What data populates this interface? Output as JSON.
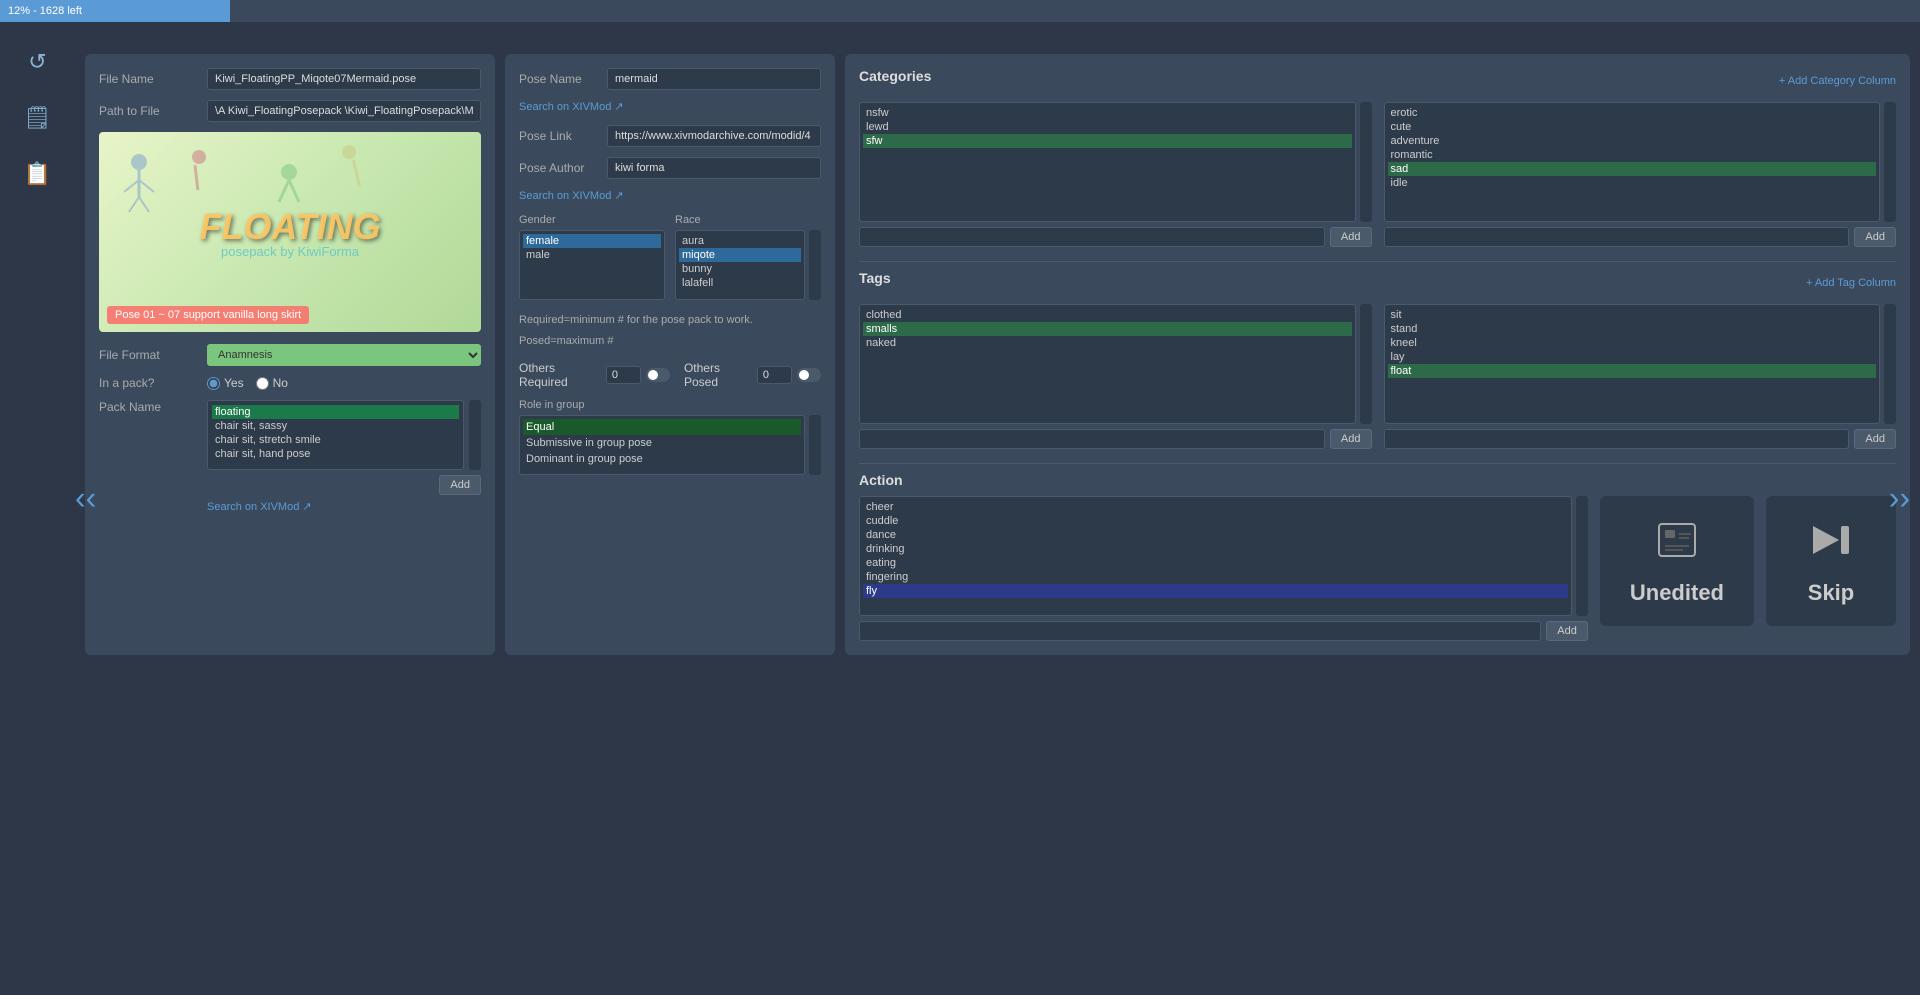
{
  "progress": {
    "text": "12% - 1628 left",
    "percent": 12
  },
  "sidebar": {
    "icons": [
      {
        "name": "refresh-icon",
        "symbol": "↺"
      },
      {
        "name": "info-icon",
        "symbol": "🗒"
      },
      {
        "name": "notes-icon",
        "symbol": "📋"
      }
    ]
  },
  "left_panel": {
    "file_name_label": "File Name",
    "file_name_value": "Kiwi_FloatingPP_Miqote07Mermaid.pose",
    "path_label": "Path to File",
    "path_value": "\\A Kiwi_FloatingPosepack \\Kiwi_FloatingPosepack\\Miqote",
    "pose_image_title": "FLOATING",
    "pose_image_subtitle": "posepack by KiwiForma",
    "pose_image_caption": "Pose 01 ~ 07 support vanilla long skirt",
    "file_format_label": "File Format",
    "file_format_value": "Anamnesis",
    "in_pack_label": "In a pack?",
    "radio_yes": "Yes",
    "radio_no": "No",
    "pack_name_label": "Pack Name",
    "pack_items": [
      {
        "label": "floating",
        "selected": true
      },
      {
        "label": "chair sit, sassy",
        "selected": false
      },
      {
        "label": "chair sit, stretch smile",
        "selected": false
      },
      {
        "label": "chair sit, hand pose",
        "selected": false
      }
    ],
    "add_label": "Add",
    "search_label": "Search on XIVMod ↗"
  },
  "middle_panel": {
    "pose_name_label": "Pose Name",
    "pose_name_value": "mermaid",
    "pose_link_label": "Pose Link",
    "pose_link_value": "https://www.xivmodarchive.com/modid/4",
    "pose_author_label": "Pose Author",
    "pose_author_value": "kiwi forma",
    "search_label": "Search on XIVMod ↗",
    "gender_label": "Gender",
    "gender_items": [
      {
        "label": "female",
        "selected": true
      },
      {
        "label": "male",
        "selected": false
      }
    ],
    "race_label": "Race",
    "race_items": [
      {
        "label": "aura",
        "selected": false
      },
      {
        "label": "miqote",
        "selected": true
      },
      {
        "label": "bunny",
        "selected": false
      },
      {
        "label": "lalafell",
        "selected": false
      }
    ],
    "required_text1": "Required=minimum # for the pose pack to work.",
    "required_text2": "Posed=maximum #",
    "others_required_label": "Others Required",
    "others_required_value": "0",
    "others_posed_label": "Others Posed",
    "others_posed_value": "0",
    "role_label": "Role in group",
    "role_items": [
      {
        "label": "Equal",
        "selected": true
      },
      {
        "label": "Submissive in group pose",
        "selected": false
      },
      {
        "label": "Dominant in group pose",
        "selected": false
      }
    ]
  },
  "right_panel": {
    "categories_title": "Categories",
    "add_category_link": "+ Add Category Column",
    "category_col1_items": [
      {
        "label": "nsfw",
        "selected": false
      },
      {
        "label": "lewd",
        "selected": false
      },
      {
        "label": "sfw",
        "selected": true
      }
    ],
    "category_col2_items": [
      {
        "label": "erotic",
        "selected": false
      },
      {
        "label": "cute",
        "selected": false
      },
      {
        "label": "adventure",
        "selected": false
      },
      {
        "label": "romantic",
        "selected": false
      },
      {
        "label": "sad",
        "selected": true
      },
      {
        "label": "idle",
        "selected": false
      }
    ],
    "tags_title": "Tags",
    "add_tag_link": "+ Add Tag Column",
    "tag_col1_items": [
      {
        "label": "clothed",
        "selected": false
      },
      {
        "label": "smalls",
        "selected": true
      },
      {
        "label": "naked",
        "selected": false
      }
    ],
    "tag_col2_items": [
      {
        "label": "sit",
        "selected": false
      },
      {
        "label": "stand",
        "selected": false
      },
      {
        "label": "kneel",
        "selected": false
      },
      {
        "label": "lay",
        "selected": false
      },
      {
        "label": "float",
        "selected": true
      }
    ],
    "action_title": "Action",
    "action_items": [
      {
        "label": "cheer",
        "selected": false
      },
      {
        "label": "cuddle",
        "selected": false
      },
      {
        "label": "dance",
        "selected": false
      },
      {
        "label": "drinking",
        "selected": false
      },
      {
        "label": "eating",
        "selected": false
      },
      {
        "label": "fingering",
        "selected": false
      },
      {
        "label": "fly",
        "selected": true
      }
    ],
    "unedited_icon": "🖼",
    "unedited_label": "Unedited",
    "skip_arrow": "⏭",
    "skip_label": "Skip",
    "add_label": "Add"
  }
}
